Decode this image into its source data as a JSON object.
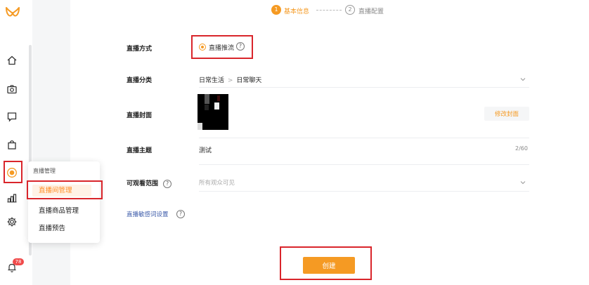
{
  "brand": {
    "accent": "#f59a23",
    "highlight_box": "#d9252b",
    "link": "#3b5aa9"
  },
  "rail": {
    "icons": [
      "logo-icon",
      "home-icon",
      "camera-icon",
      "message-icon",
      "bag-icon",
      "live-icon",
      "chart-icon",
      "gear-icon",
      "bell-icon"
    ],
    "notification_count": "78"
  },
  "popover": {
    "title": "直播管理",
    "items": [
      {
        "label": "直播间管理",
        "active": true
      },
      {
        "label": "直播商品管理",
        "active": false
      },
      {
        "label": "直播预告",
        "active": false
      }
    ]
  },
  "steps": [
    {
      "num": "1",
      "label": "基本信息",
      "active": true
    },
    {
      "num": "2",
      "label": "直播配置",
      "active": false
    }
  ],
  "form": {
    "method": {
      "label": "直播方式",
      "option": "直播推流",
      "help": "?"
    },
    "category": {
      "label": "直播分类",
      "primary": "日常生活",
      "separator": ">",
      "secondary": "日常聊天"
    },
    "cover": {
      "label": "直播封面",
      "button": "修改封面"
    },
    "topic": {
      "label": "直播主题",
      "value": "测试",
      "counter": "2/60"
    },
    "visibility": {
      "label": "可观看范围",
      "help": "?",
      "placeholder": "所有观众可见"
    },
    "sensitive_link": {
      "label": "直播敏感词设置",
      "help": "?"
    }
  },
  "actions": {
    "create": "创建"
  }
}
